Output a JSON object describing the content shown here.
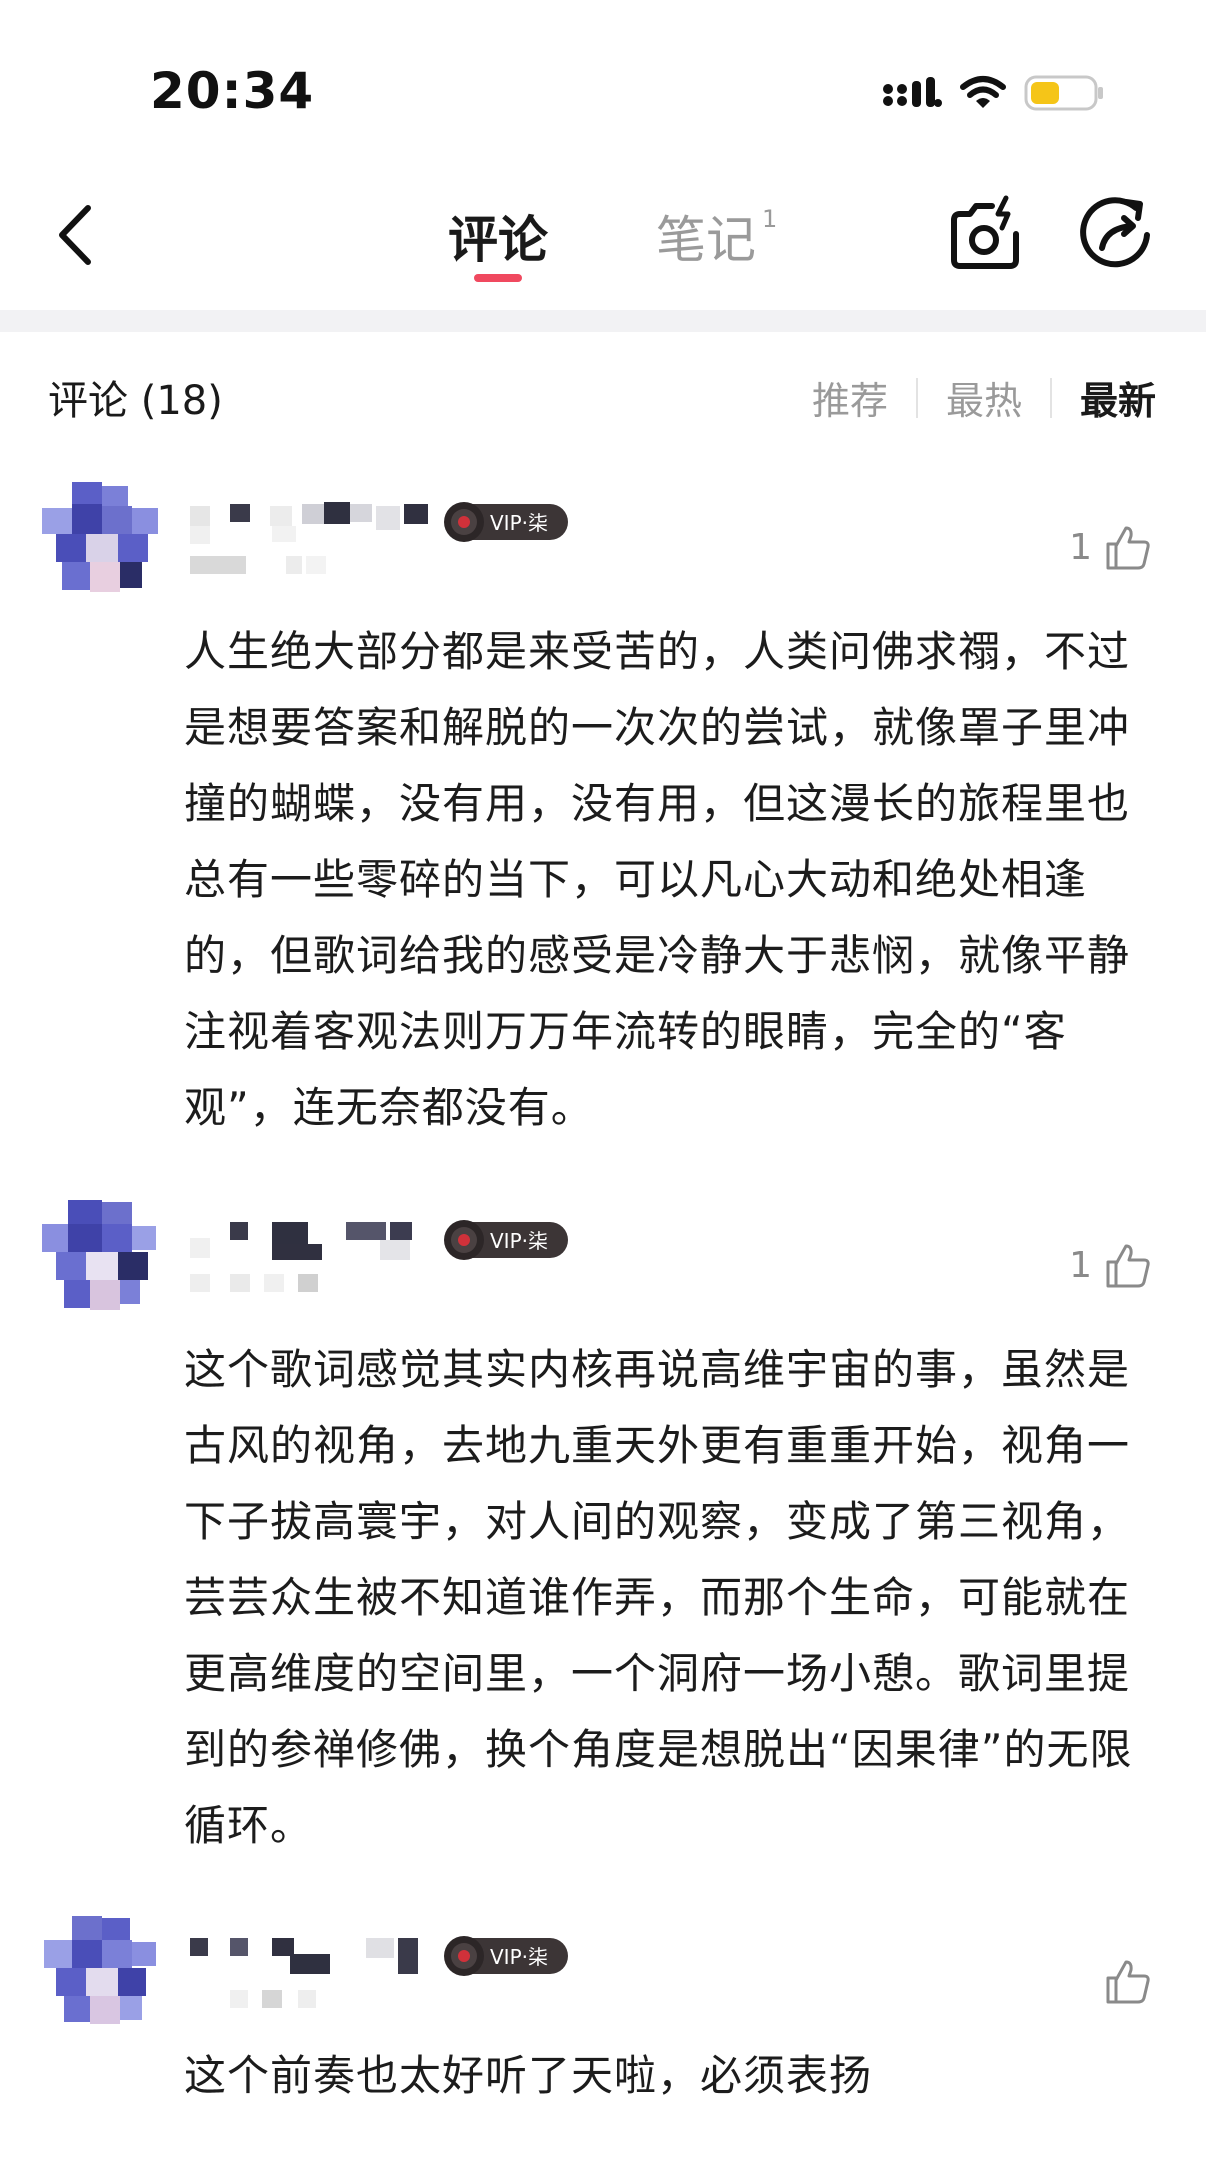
{
  "status_bar": {
    "time": "20:34",
    "battery_color": "#f5c518"
  },
  "header": {
    "tabs": [
      {
        "label": "评论",
        "active": true
      },
      {
        "label": "笔记",
        "badge": "1",
        "active": false
      }
    ],
    "accent": "#f0495f",
    "icons": [
      "back-icon",
      "camera-icon",
      "share-icon"
    ]
  },
  "comments_section": {
    "count_label": "评论 (18)",
    "sort": [
      "推荐",
      "最热",
      "最新"
    ],
    "active_sort": "最新"
  },
  "vip_badge": "VIP·柒",
  "comments": [
    {
      "likes": "1",
      "text": "人生绝大部分都是来受苦的，人类问佛求禤，不过是想要答案和解脱的一次次的尝试，就像罩子里冲撞的蝴蝶，没有用，没有用，但这漫长的旅程里也总有一些零碎的当下，可以凡心大动和绝处相逢的，但歌词给我的感受是冷静大于悲悯，就像平静注视着客观法则万万年流转的眼睛，完全的“客观”，连无奈都没有。"
    },
    {
      "likes": "1",
      "text": "这个歌词感觉其实内核再说高维宇宙的事，虽然是古风的视角，去地九重天外更有重重开始，视角一下子拔高寰宇，对人间的观察，变成了第三视角，芸芸众生被不知道谁作弄，而那个生命，可能就在更高维度的空间里，一个洞府一场小憩。歌词里提到的参禅修佛，换个角度是想脱出“因果律”的无限循环。"
    },
    {
      "likes": "",
      "text": "这个前奏也太好听了天啦，必须表扬"
    }
  ]
}
